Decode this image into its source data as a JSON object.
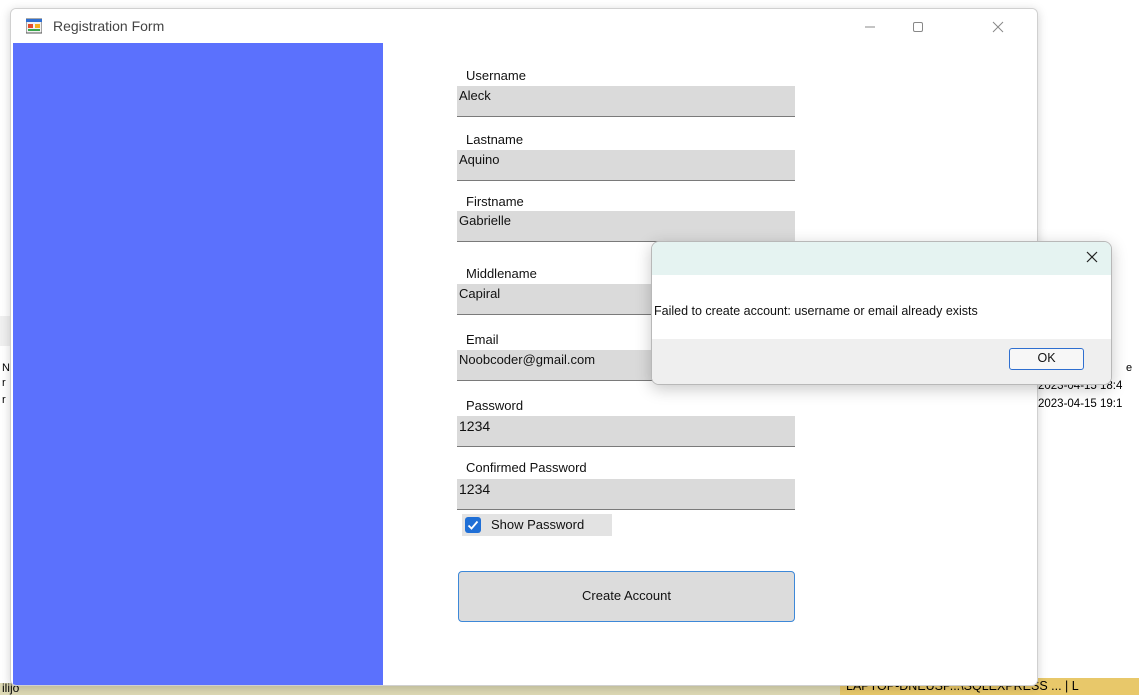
{
  "window": {
    "title": "Registration Form",
    "minimize_glyph": "—",
    "maximize_glyph": "☐"
  },
  "form": {
    "username_label": "Username",
    "username_value": "Aleck",
    "lastname_label": "Lastname",
    "lastname_value": "Aquino",
    "firstname_label": "Firstname",
    "firstname_value": "Gabrielle",
    "middlename_label": "Middlename",
    "middlename_value": "Capiral",
    "email_label": "Email",
    "email_value": "Noobcoder@gmail.com",
    "password_label": "Password",
    "password_value": "1234",
    "confirm_label": "Confirmed Password",
    "confirm_value": "1234",
    "show_password_label": "Show Password",
    "show_password_checked": true,
    "create_button": "Create Account"
  },
  "dialog": {
    "message": "Failed to create account: username or email already exists",
    "ok_label": "OK"
  },
  "background": {
    "timestamp_1": "2023-04-15 18:4",
    "timestamp_2": "2023-04-15 19:1",
    "fragment_right": "e",
    "left_chars": [
      "N",
      "r",
      "r"
    ],
    "bottom_left_text": "ilijo",
    "status_text": "LAPTOP-DNEUSP...\\SQLEXPRESS ...  |  L"
  },
  "colors": {
    "side_panel": "#5b71fd",
    "field_bg": "#dadada",
    "accent": "#1f6fd6",
    "dialog_title_bg": "#e5f3f1"
  }
}
